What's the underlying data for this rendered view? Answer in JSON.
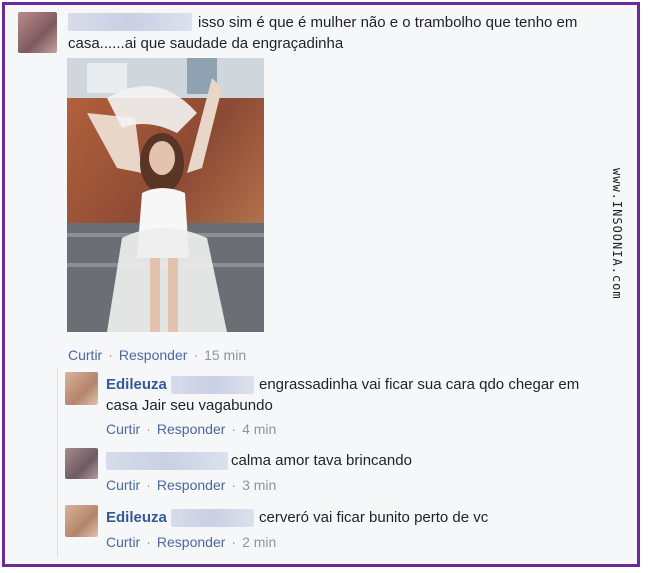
{
  "post": {
    "text": "isso sim é que é mulher não e o trambolho que tenho em casa......ai que saudade da engraçadinha",
    "line1": "isso sim é que é mulher não e o trambolho que tenho em",
    "line2": "casa......ai que saudade da engraçadinha",
    "like_label": "Curtir",
    "reply_label": "Responder",
    "time": "15 min"
  },
  "replies": [
    {
      "name": "Edileuza",
      "line1": "engrassadinha vai ficar sua cara qdo chegar em",
      "line2": "casa Jair seu vagabundo",
      "like_label": "Curtir",
      "reply_label": "Responder",
      "time": "4 min"
    },
    {
      "name": "",
      "line1": "calma amor tava brincando",
      "like_label": "Curtir",
      "reply_label": "Responder",
      "time": "3 min"
    },
    {
      "name": "Edileuza",
      "line1": "cerveró vai ficar bunito perto de vc",
      "like_label": "Curtir",
      "reply_label": "Responder",
      "time": "2 min"
    }
  ],
  "watermark": "www.INSOONIA.com",
  "colors": {
    "border": "#6a2a9a",
    "link": "#365899",
    "meta": "#90949c"
  }
}
